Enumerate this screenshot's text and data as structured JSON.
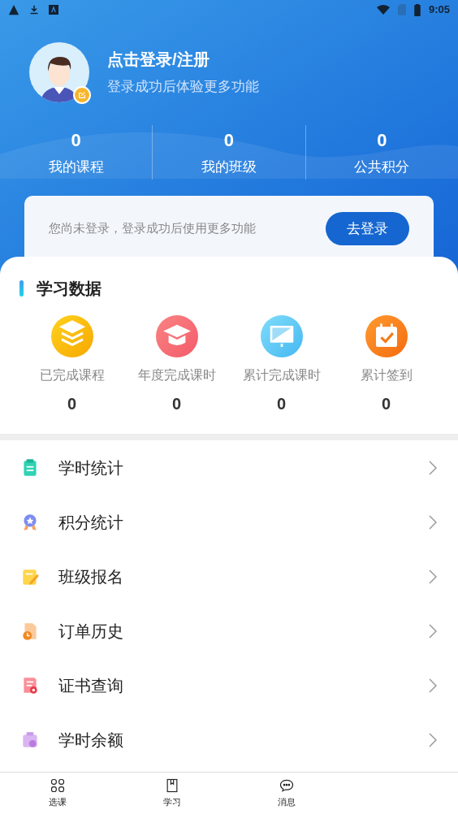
{
  "status_bar": {
    "time": "9:05"
  },
  "profile": {
    "title": "点击登录/注册",
    "subtitle": "登录成功后体验更多功能"
  },
  "stats": [
    {
      "value": "0",
      "label": "我的课程"
    },
    {
      "value": "0",
      "label": "我的班级"
    },
    {
      "value": "0",
      "label": "公共积分"
    }
  ],
  "login_card": {
    "message": "您尚未登录，登录成功后使用更多功能",
    "button": "去登录"
  },
  "study_data": {
    "title": "学习数据",
    "items": [
      {
        "kind": "layers",
        "label": "已完成课程",
        "value": "0"
      },
      {
        "kind": "cap",
        "label": "年度完成课时",
        "value": "0"
      },
      {
        "kind": "monitor",
        "label": "累计完成课时",
        "value": "0"
      },
      {
        "kind": "calendar",
        "label": "累计签到",
        "value": "0"
      }
    ]
  },
  "menu": [
    {
      "kind": "clipboard",
      "label": "学时统计"
    },
    {
      "kind": "medal",
      "label": "积分统计"
    },
    {
      "kind": "note",
      "label": "班级报名"
    },
    {
      "kind": "history",
      "label": "订单历史"
    },
    {
      "kind": "certificate",
      "label": "证书查询"
    },
    {
      "kind": "wallet",
      "label": "学时余额"
    }
  ],
  "bottom_nav": [
    {
      "kind": "grid",
      "label": "选课"
    },
    {
      "kind": "book",
      "label": "学习"
    },
    {
      "kind": "chat",
      "label": "消息"
    }
  ]
}
